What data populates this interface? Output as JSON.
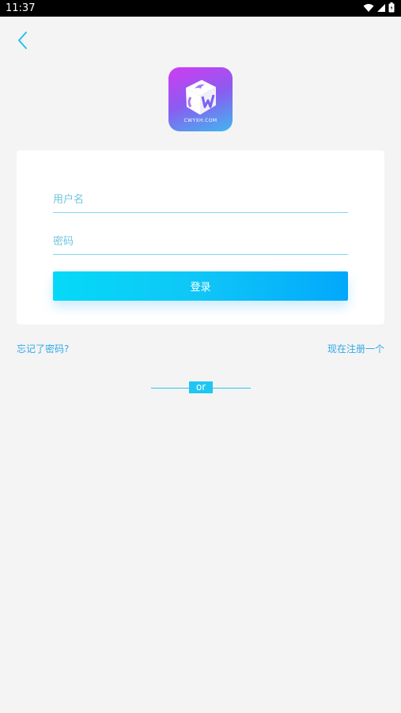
{
  "status_bar": {
    "time": "11:37",
    "icons": [
      "wifi-icon",
      "signal-icon",
      "battery-icon"
    ]
  },
  "header": {
    "back_icon": "chevron-left-icon"
  },
  "logo": {
    "text": "CWYXH.COM"
  },
  "form": {
    "username_placeholder": "用户名",
    "password_placeholder": "密码",
    "username_value": "",
    "password_value": "",
    "login_label": "登录"
  },
  "links": {
    "forgot_password": "忘记了密码?",
    "register": "现在注册一个"
  },
  "divider": {
    "label": "or"
  },
  "colors": {
    "accent": "#1ec6f3",
    "link": "#31a9e4",
    "background": "#f4f4f5",
    "logo_gradient_start": "#d13bf2",
    "logo_gradient_end": "#3fb8ef"
  }
}
